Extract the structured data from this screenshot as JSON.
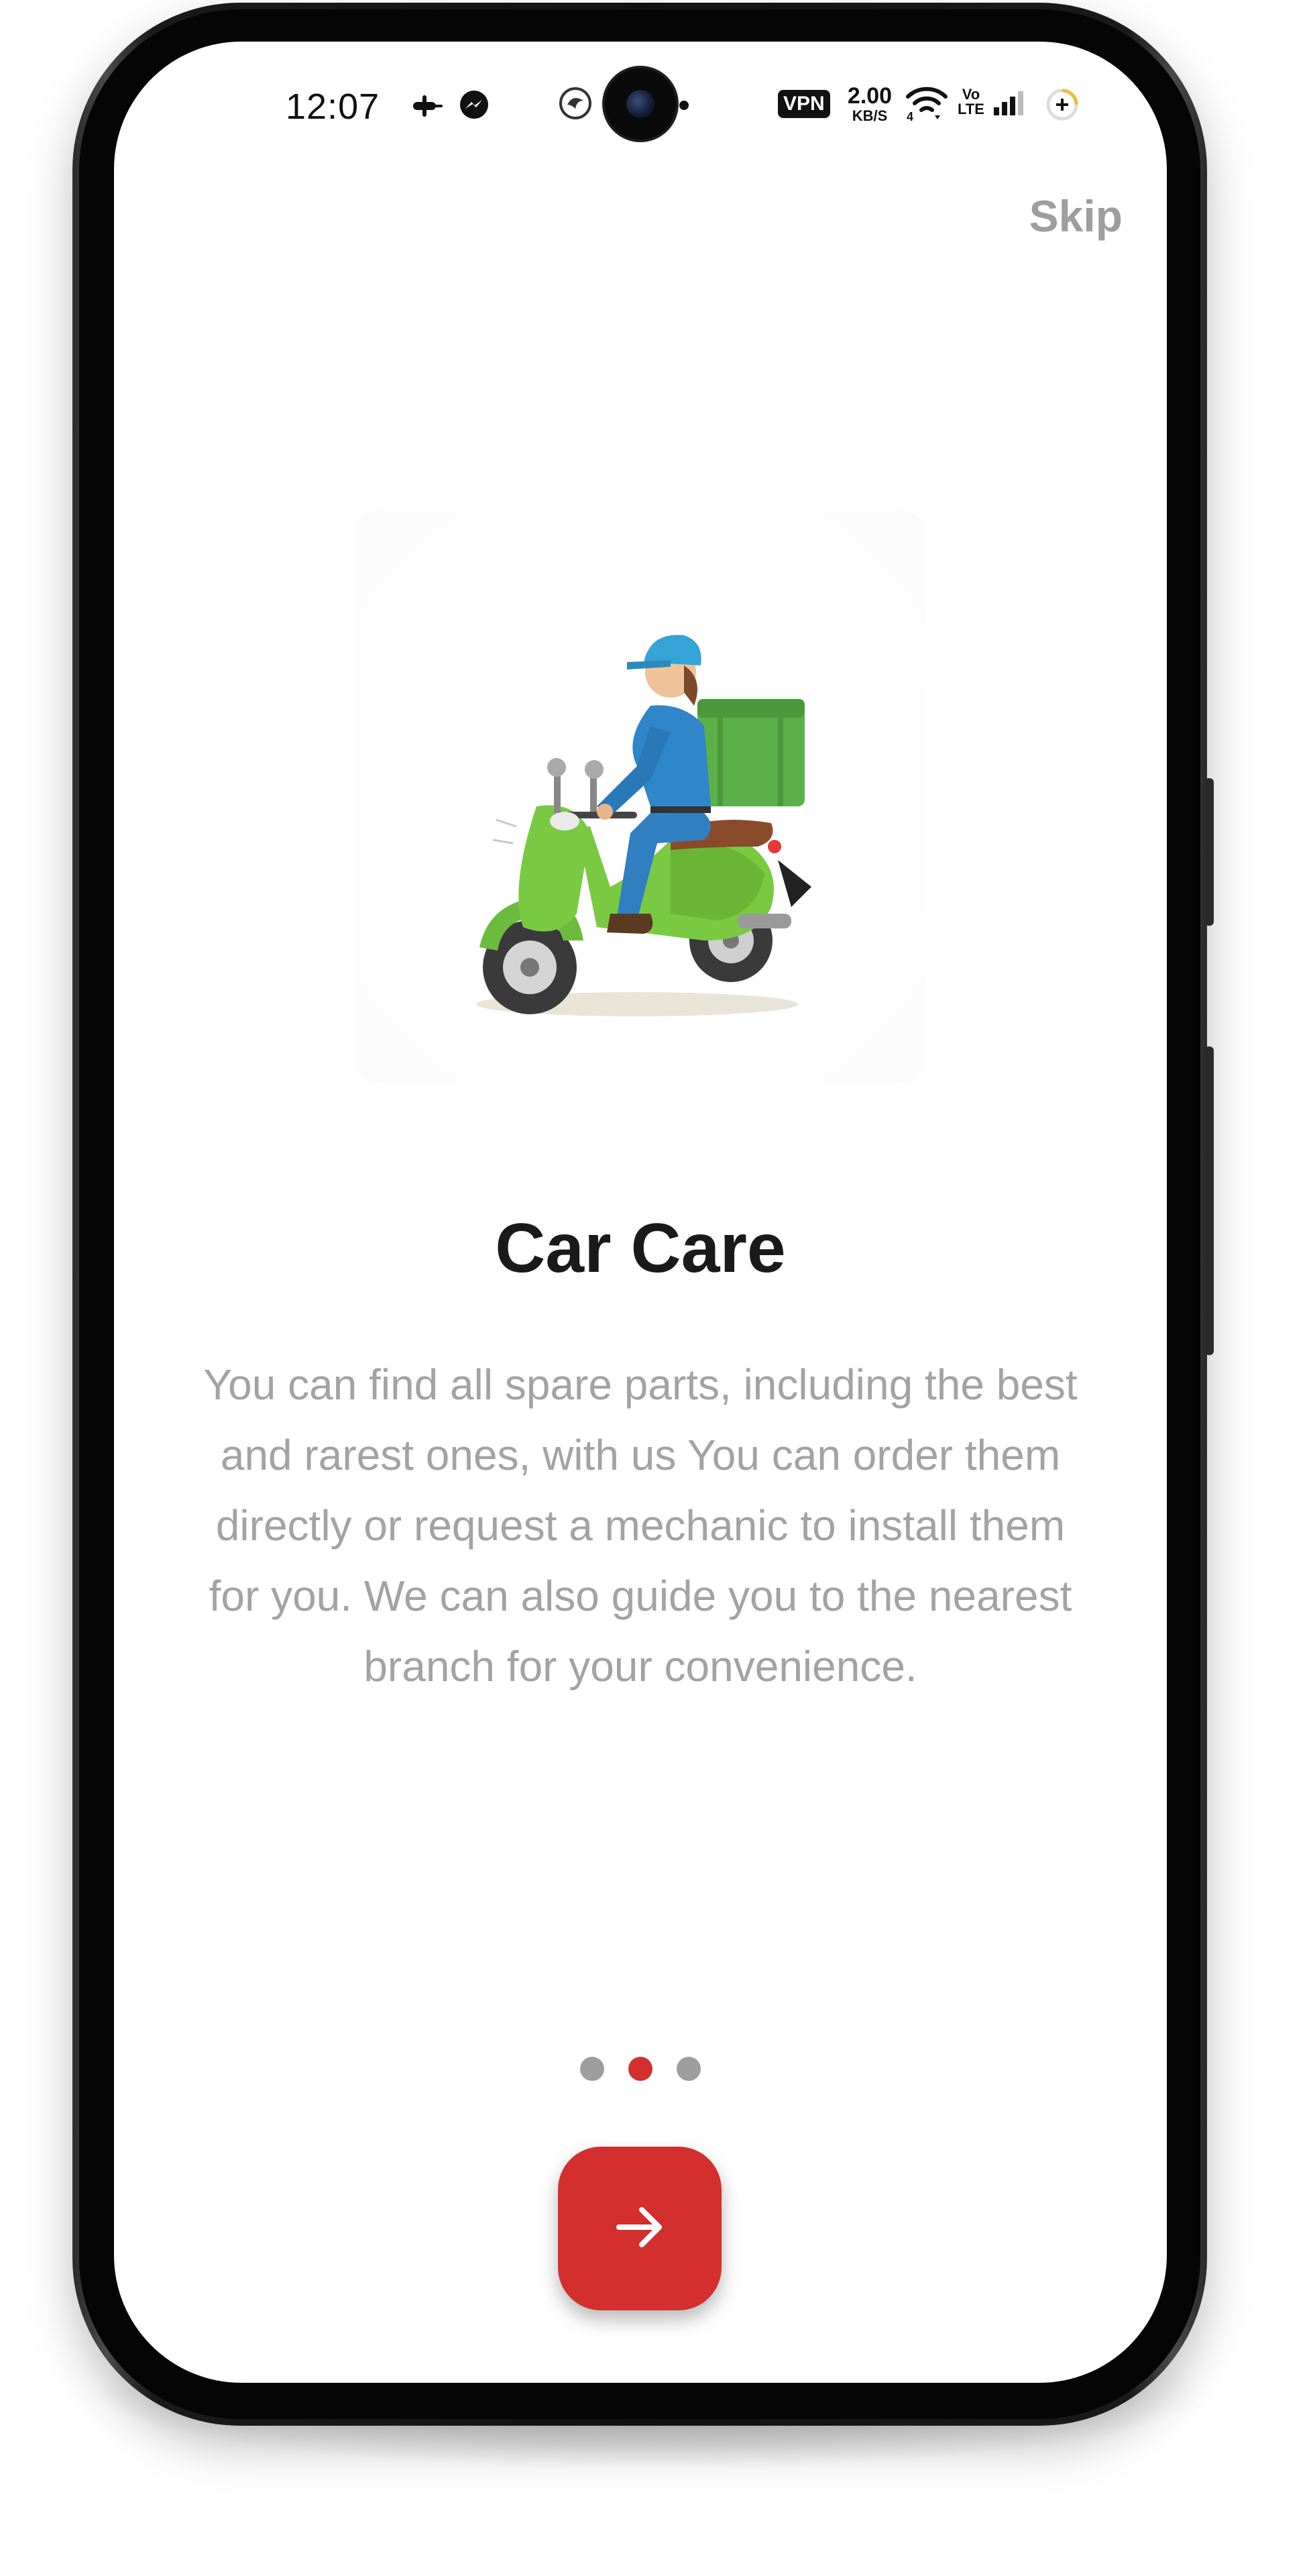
{
  "status_bar": {
    "time": "12:07",
    "vpn": "VPN",
    "speed_value": "2.00",
    "speed_unit": "KB/S",
    "volte_line1": "Vo",
    "volte_line2": "LTE",
    "wifi_generation": "4",
    "icons": [
      "notification-icon",
      "messenger-icon",
      "app-notification-icon",
      "wifi-icon",
      "signal-icon",
      "battery-saver-icon"
    ]
  },
  "onboarding": {
    "skip_label": "Skip",
    "illustration": "scooter-delivery-illustration",
    "title": "Car Care",
    "description": "You can find all spare parts, including the best and rarest ones, with us You can order them directly or request a mechanic to install them for you. We can also guide you to the nearest branch for your convenience.",
    "page_count": 3,
    "current_page": 2,
    "next_icon": "arrow-right-icon"
  },
  "colors": {
    "accent": "#d32f2f",
    "inactive_dot": "#9e9e9e",
    "title_text": "#1a1a1a",
    "body_text": "#a3a3a3",
    "skip_text": "#9e9e9e"
  }
}
